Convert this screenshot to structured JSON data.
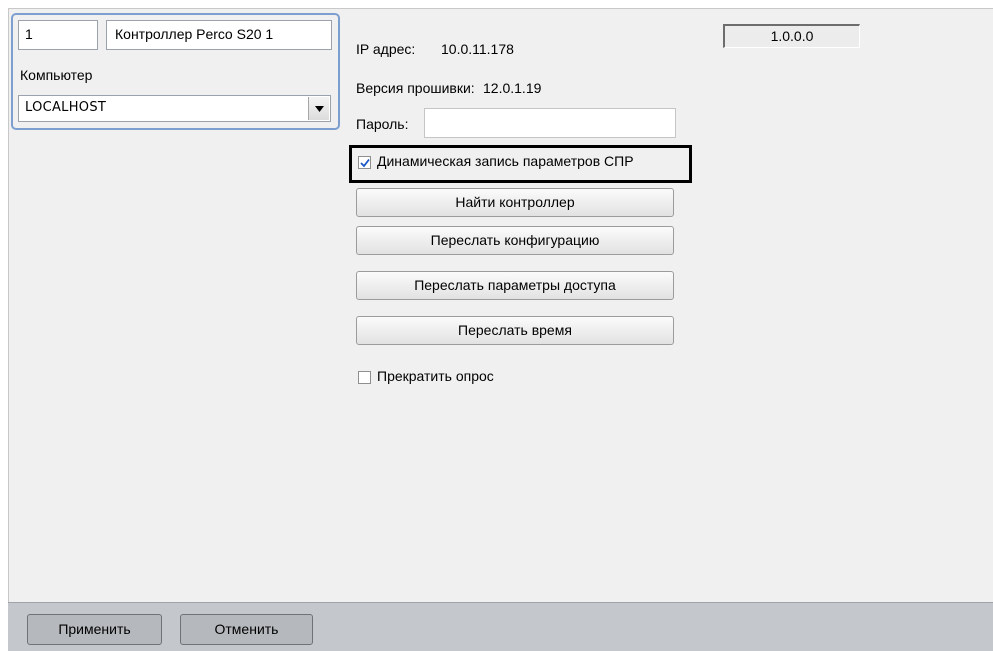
{
  "object": {
    "id": "1",
    "name": "Контроллер Perco S20 1",
    "computer_label": "Компьютер",
    "computer_value": "LOCALHOST"
  },
  "device": {
    "version": "1.0.0.0",
    "ip_label": "IP адрес:",
    "ip_value": "10.0.11.178",
    "firmware_label": "Версия прошивки:",
    "firmware_value": "12.0.1.19",
    "password_label": "Пароль:",
    "password_value": ""
  },
  "options": {
    "dynamic_write_label": "Динамическая запись параметров СПР",
    "dynamic_write_checked": true,
    "stop_polling_label": "Прекратить опрос",
    "stop_polling_checked": false
  },
  "actions": {
    "find_controller": "Найти контроллер",
    "send_config": "Переслать конфигурацию",
    "send_access": "Переслать параметры доступа",
    "send_time": "Переслать время"
  },
  "footer": {
    "apply": "Применить",
    "cancel": "Отменить"
  },
  "icons": {
    "combo_arrow": "chevron-down-icon",
    "checkmark": "checkmark-icon"
  }
}
